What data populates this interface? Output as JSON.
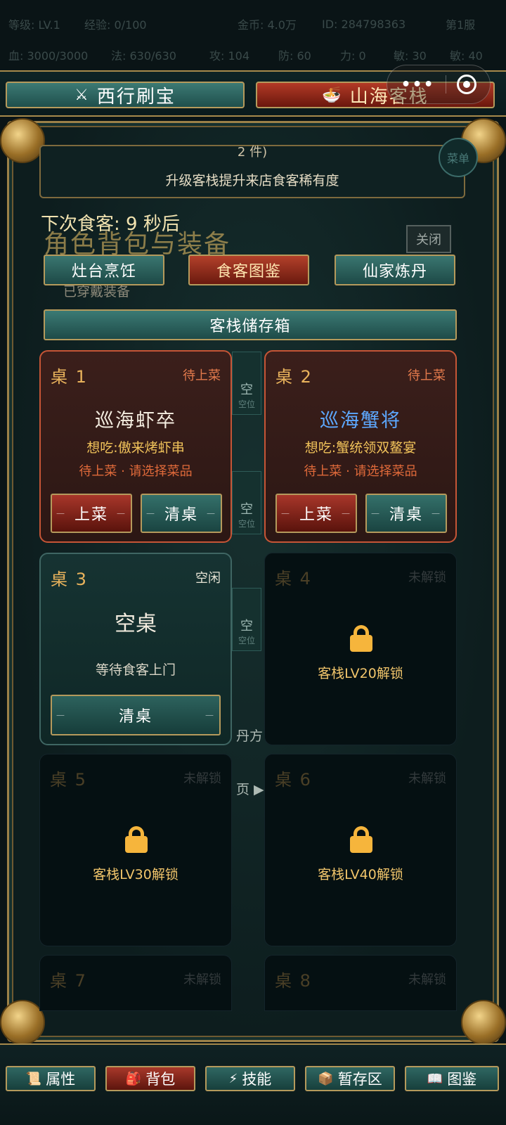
{
  "status": {
    "row1": [
      "等级: LV.1",
      "经验: 0/100",
      "金币: 4.0万",
      "ID: 284798363",
      "第1服"
    ],
    "row2": [
      "血: 3000/3000",
      "法: 630/630",
      "攻: 104",
      "防: 60",
      "力: 0",
      "敏: 30",
      "敏: 40"
    ]
  },
  "capsule": {
    "more": "•••"
  },
  "top_tabs": [
    {
      "icon": "⚔",
      "label": "西行刷宝"
    },
    {
      "icon": "🍜",
      "label": "山海客栈"
    }
  ],
  "notice": {
    "cut_line": "2 件)",
    "line2": "升级客栈提升来店食客稀有度"
  },
  "menu_label": "菜单",
  "countdown": "下次食客: 9 秒后",
  "ghost_title": "角色背包与装备",
  "ghost_equipped": "已穿戴装备",
  "close_label": "关闭",
  "sub_tabs": [
    "灶台烹饪",
    "食客图鉴",
    "仙家炼丹"
  ],
  "storage_label": "客栈储存箱",
  "bg": {
    "slot_empty": "空",
    "slot_sub": "空位",
    "text1": "丹方",
    "text2": "页 ▶"
  },
  "tables": [
    {
      "name": "桌 1",
      "status": "待上菜",
      "guest": "巡海虾卒",
      "want": "想吃:傲来烤虾串",
      "hint": "待上菜 · 请选择菜品",
      "serve": "上菜",
      "clear": "清桌"
    },
    {
      "name": "桌 2",
      "status": "待上菜",
      "guest": "巡海蟹将",
      "want": "想吃:蟹统领双鳌宴",
      "hint": "待上菜 · 请选择菜品",
      "serve": "上菜",
      "clear": "清桌"
    },
    {
      "name": "桌 3",
      "status": "空闲",
      "main": "空桌",
      "sub": "等待食客上门",
      "clear": "清桌"
    },
    {
      "name": "桌 4",
      "status": "未解锁",
      "unlock": "客栈LV20解锁"
    },
    {
      "name": "桌 5",
      "status": "未解锁",
      "unlock": "客栈LV30解锁"
    },
    {
      "name": "桌 6",
      "status": "未解锁",
      "unlock": "客栈LV40解锁"
    },
    {
      "name": "桌 7",
      "status": "未解锁"
    },
    {
      "name": "桌 8",
      "status": "未解锁"
    }
  ],
  "bottom_nav": [
    {
      "icon": "📜",
      "label": "属性"
    },
    {
      "icon": "🎒",
      "label": "背包"
    },
    {
      "icon": "⚡",
      "label": "技能"
    },
    {
      "icon": "📦",
      "label": "暂存区"
    },
    {
      "icon": "📖",
      "label": "图鉴"
    }
  ],
  "colors": {
    "accent_gold": "#b59a5c",
    "serve_red": "#a8362a",
    "teal": "#34706a",
    "rare_blue": "#5da8ff"
  }
}
